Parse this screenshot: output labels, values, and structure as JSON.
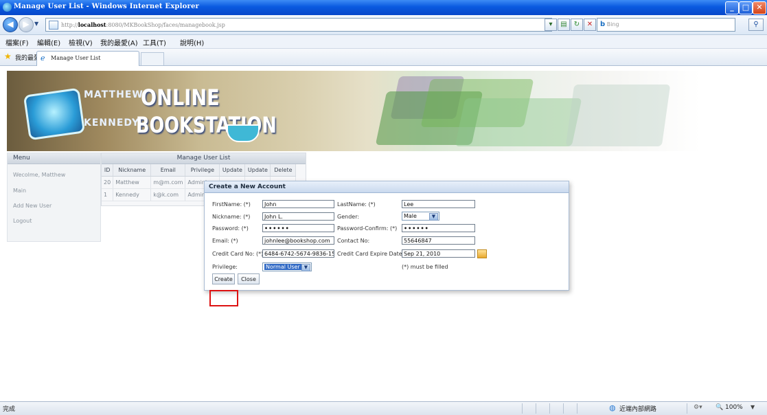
{
  "window": {
    "title": "Manage User List - Windows Internet Explorer",
    "controls": [
      "_",
      "□",
      "✕"
    ]
  },
  "addressbar": {
    "url_prefix": "http://",
    "url_host": "localhost",
    "url_rest": ":8080/MKBookShop/faces/managebook.jsp",
    "search_engine": "Bing"
  },
  "menubar": {
    "items": [
      "檔案(F)",
      "編輯(E)",
      "檢視(V)",
      "我的最愛(A)",
      "工具(T)",
      "說明(H)"
    ]
  },
  "favorites": {
    "label": "我的最愛",
    "tab_title": "Manage User List"
  },
  "banner": {
    "logo_line1_small": "MATTHEW",
    "logo_line1_big": "ONLINE",
    "logo_line2_small": "KENNEDY",
    "logo_line2_big": "BOOKSTATION"
  },
  "sidebar": {
    "header": "Menu",
    "items": [
      "Wecolme, Matthew",
      "Main",
      "Add New User",
      "Logout"
    ]
  },
  "user_list": {
    "title": "Manage User List",
    "columns": [
      "ID",
      "Nickname",
      "Email",
      "Privilege",
      "Update",
      "Update",
      "Delete"
    ],
    "rows": [
      [
        "20",
        "Matthew",
        "m@m.com",
        "Adminis"
      ],
      [
        "1",
        "Kennedy",
        "k@k.com",
        "Adminis"
      ]
    ]
  },
  "dialog": {
    "title": "Create a New Account",
    "firstname_label": "FirstName: (*)",
    "firstname_value": "John",
    "lastname_label": "LastName: (*)",
    "lastname_value": "Lee",
    "nickname_label": "Nickname: (*)",
    "nickname_value": "John L.",
    "gender_label": "Gender:",
    "gender_value": "Male",
    "password_label": "Password: (*)",
    "password_value": "••••••",
    "password_confirm_label": "Password-Confirm: (*)",
    "password_confirm_value": "••••••",
    "email_label": "Email: (*)",
    "email_value": "johnlee@bookshop.com",
    "contact_label": "Contact No:",
    "contact_value": "55646847",
    "cc_label": "Credit Card No: (*)",
    "cc_value": "6484-6742-5674-9836-15",
    "cc_expire_label": "Credit Card Expire Date:",
    "cc_expire_value": "Sep 21, 2010",
    "privilege_label": "Privilege:",
    "privilege_value": "Normal User",
    "required_note": "(*) must be filled",
    "create_button": "Create",
    "close_button": "Close"
  },
  "statusbar": {
    "status": "完成",
    "zone": "近端內部網路",
    "zoom": "100%"
  }
}
